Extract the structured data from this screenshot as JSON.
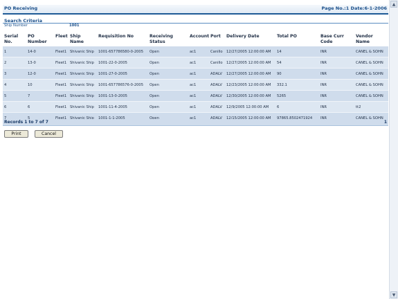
{
  "header": {
    "title": "PO Receiving",
    "page_info": "Page No.:1  Date:6-1-2006"
  },
  "search": {
    "heading": "Search Criteria",
    "ship_number_label": "Ship Number",
    "ship_number_value": "1001"
  },
  "columns": [
    "Serial No.",
    "PO Number",
    "Fleet",
    "Ship Name",
    "Requisition No",
    "Receiving Status",
    "Account",
    "Port",
    "Delivery Date",
    "Total PO",
    "Base Curr Code",
    "Vendor Name"
  ],
  "rows": [
    [
      "1",
      "14-0",
      "Fleet1",
      "Shivanic Ship",
      "1001-657786580-0-2005",
      "Open",
      "ac1",
      "Canillo",
      "12/27/2005 12:00:00 AM",
      "14",
      "INR",
      "CANEL & SOHN"
    ],
    [
      "2",
      "13-0",
      "Fleet1",
      "Shivanic Ship",
      "1001-22-0-2005",
      "Open",
      "ac1",
      "Canillo",
      "12/27/2005 12:00:00 AM",
      "54",
      "INR",
      "CANEL & SOHN"
    ],
    [
      "3",
      "12-0",
      "Fleet1",
      "Shivanic Ship",
      "1001-27-0-2005",
      "Open",
      "ac1",
      "ADALV",
      "12/27/2005 12:00:00 AM",
      "90",
      "INR",
      "CANEL & SOHN"
    ],
    [
      "4",
      "10",
      "Fleet1",
      "Shivanic Ship",
      "1001-657786576-0-2005",
      "Open",
      "ac1",
      "ADALV",
      "12/23/2005 12:00:00 AM",
      "332.1",
      "INR",
      "CANEL & SOHN"
    ],
    [
      "5",
      "7",
      "Fleet1",
      "Shivanic Ship",
      "1001-13-0-2005",
      "Open",
      "ac1",
      "ADALV",
      "12/30/2005 12:00:00 AM",
      "5265",
      "INR",
      "CANEL & SOHN"
    ],
    [
      "6",
      "6",
      "Fleet1",
      "Shivanic Ship",
      "1001-11-4-2005",
      "Open",
      "ac1",
      "ADALV",
      "12/9/2005 12:00:00 AM",
      "6",
      "INR",
      "tt2"
    ],
    [
      "7",
      "5",
      "Fleet1",
      "Shivanic Ship",
      "1001-1-1-2005",
      "Open",
      "ac1",
      "ADALV",
      "12/15/2005 12:00:00 AM",
      "97865.8502471924",
      "INR",
      "CANEL & SOHN"
    ]
  ],
  "footer": {
    "records_text": "Records 1 to 7 of 7",
    "page_number": "1"
  },
  "buttons": {
    "print": "Print",
    "cancel": "Cancel"
  },
  "colors": {
    "header_text": "#1a4f8a",
    "row_odd": "#cfdcec",
    "row_even": "#dde7f2",
    "accent_line": "#1e5a96"
  }
}
